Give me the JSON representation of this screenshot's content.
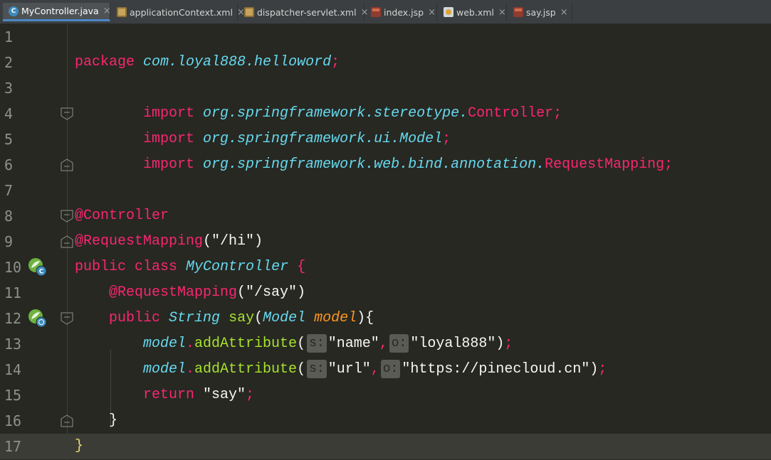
{
  "tabs": [
    {
      "label": "MyController.java",
      "icon": "java-class-icon",
      "active": true
    },
    {
      "label": "applicationContext.xml",
      "icon": "xml-file-icon"
    },
    {
      "label": "dispatcher-servlet.xml",
      "icon": "xml-file-icon"
    },
    {
      "label": "index.jsp",
      "icon": "jsp-file-icon"
    },
    {
      "label": "web.xml",
      "icon": "web-xml-icon"
    },
    {
      "label": "say.jsp",
      "icon": "jsp-file-icon"
    }
  ],
  "tab_close_glyph": "×",
  "line_numbers": [
    "1",
    "2",
    "3",
    "4",
    "5",
    "6",
    "7",
    "8",
    "9",
    "10",
    "11",
    "12",
    "13",
    "14",
    "15",
    "16",
    "17"
  ],
  "code": {
    "l2": {
      "kw": "package",
      "pkg": "com.loyal888.helloword",
      "semi": ";"
    },
    "l4": {
      "kw": "import",
      "pkg": "org.springframework.stereotype.",
      "cls": "Controller",
      "semi": ";"
    },
    "l5": {
      "kw": "import",
      "pkg": "org.springframework.ui.Model",
      "semi": ";"
    },
    "l6": {
      "kw": "import",
      "pkg": "org.springframework.web.bind.annotation.",
      "cls": "RequestMapping",
      "semi": ";"
    },
    "l8": {
      "ann": "@Controller"
    },
    "l9": {
      "ann": "@RequestMapping",
      "open": "(",
      "str": "\"/hi\"",
      "close": ")"
    },
    "l10": {
      "kw": "public class",
      "name": "MyController",
      "brace": "{"
    },
    "l11": {
      "ann": "@RequestMapping",
      "open": "(",
      "str": "\"/say\"",
      "close": ")"
    },
    "l12": {
      "kw": "public",
      "type": "String",
      "method": "say",
      "open": "(",
      "ptype": "Model",
      "pname": "model",
      "close": "){"
    },
    "l13": {
      "obj": "model",
      "dot": ".",
      "call": "addAttribute",
      "open": "(",
      "hint1": "s:",
      "arg1": "\"name\"",
      "comma": ",",
      "hint2": "o:",
      "arg2": "\"loyal888\"",
      "close": ")",
      "semi": ";"
    },
    "l14": {
      "obj": "model",
      "dot": ".",
      "call": "addAttribute",
      "open": "(",
      "hint1": "s:",
      "arg1": "\"url\"",
      "comma": ",",
      "hint2": "o:",
      "arg2": "\"https://pinecloud.cn\"",
      "close": ")",
      "semi": ";"
    },
    "l15": {
      "kw": "return",
      "str": "\"say\"",
      "semi": ";"
    },
    "l16": {
      "brace": "}"
    },
    "l17": {
      "brace": "}"
    }
  },
  "colors": {
    "background": "#272822",
    "keyword": "#f92672",
    "italic_type": "#66d9ef",
    "default_text": "#f8f8f2",
    "current_line": "#3b3c36",
    "tab_bar": "#3c3f41",
    "active_tab_underline": "#4a88c7"
  }
}
